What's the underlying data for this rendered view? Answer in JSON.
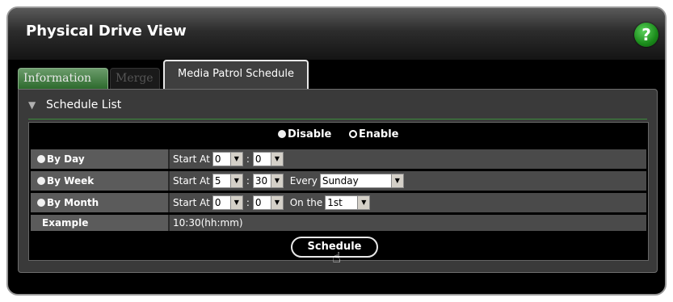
{
  "window": {
    "title": "Physical Drive View",
    "help_label": "?"
  },
  "tabs": [
    {
      "label": "Information",
      "active": false
    },
    {
      "label": "Merge",
      "active": false
    },
    {
      "label": "Media Patrol Schedule",
      "active": true
    }
  ],
  "schedule_list": {
    "title": "Schedule List",
    "toggle": {
      "disable_label": "Disable",
      "enable_label": "Enable",
      "selected": "Enable"
    },
    "rows": {
      "by_day": {
        "label": "By Day",
        "start_at_label": "Start At",
        "hour": "0",
        "minute": "0",
        "sep": ":"
      },
      "by_week": {
        "label": "By Week",
        "start_at_label": "Start At",
        "hour": "5",
        "minute": "30",
        "sep": ":",
        "every_label": "Every",
        "day": "Sunday"
      },
      "by_month": {
        "label": "By Month",
        "start_at_label": "Start At",
        "hour": "0",
        "minute": "0",
        "sep": ":",
        "on_the_label": "On the",
        "day_of_month": "1st"
      },
      "example": {
        "label": "Example",
        "value": "10:30(hh:mm)"
      }
    },
    "schedule_button": "Schedule"
  },
  "colors": {
    "accent_green": "#2d6a2d",
    "help_green": "#1a8a1a",
    "panel": "#3a3a3a"
  }
}
